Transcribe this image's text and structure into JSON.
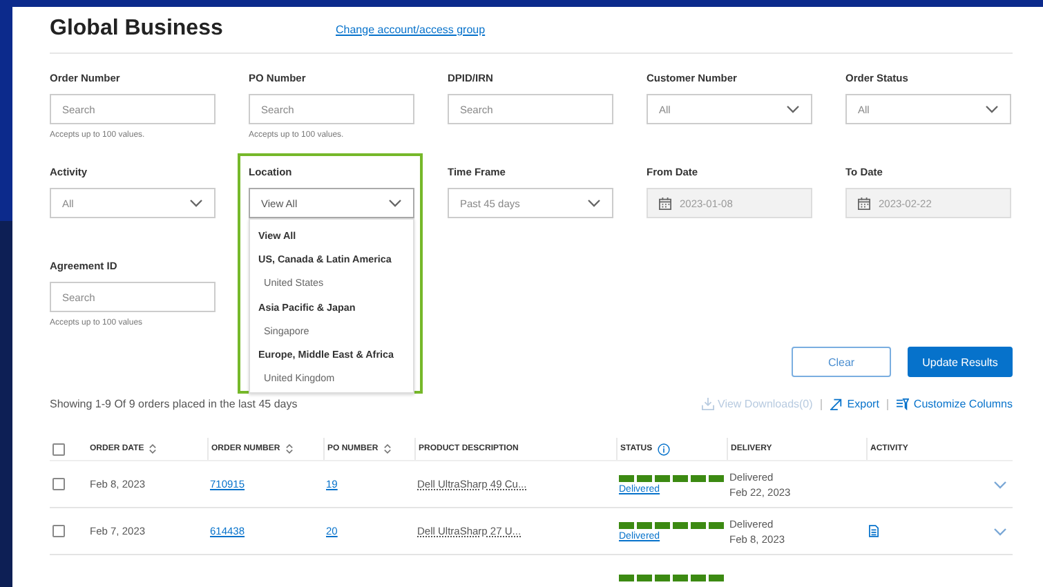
{
  "header": {
    "title": "Global Business",
    "link": "Change account/access group"
  },
  "filters": [
    {
      "kind": "text",
      "label": "Order Number",
      "placeholder": "Search",
      "help": "Accepts up to 100 values."
    },
    {
      "kind": "text",
      "label": "PO Number",
      "placeholder": "Search",
      "help": "Accepts up to 100 values."
    },
    {
      "kind": "text",
      "label": "DPID/IRN",
      "placeholder": "Search"
    },
    {
      "kind": "select",
      "label": "Customer Number",
      "value": "All"
    },
    {
      "kind": "select",
      "label": "Order Status",
      "value": "All"
    },
    {
      "kind": "select",
      "label": "Activity",
      "value": "All"
    },
    {
      "kind": "select",
      "label": "Location",
      "value": "View All",
      "focused": true,
      "open": true,
      "options": [
        {
          "kind": "group",
          "label": "View All"
        },
        {
          "kind": "group",
          "label": "US, Canada & Latin America"
        },
        {
          "kind": "item",
          "label": "United States"
        },
        {
          "kind": "group",
          "label": "Asia Pacific & Japan"
        },
        {
          "kind": "item",
          "label": "Singapore"
        },
        {
          "kind": "group",
          "label": "Europe, Middle East & Africa"
        },
        {
          "kind": "item",
          "label": "United Kingdom"
        }
      ]
    },
    {
      "kind": "select",
      "label": "Time Frame",
      "value": "Past 45 days"
    },
    {
      "kind": "date",
      "label": "From Date",
      "value": "2023-01-08",
      "disabled": true
    },
    {
      "kind": "date",
      "label": "To Date",
      "value": "2023-02-22",
      "disabled": true
    },
    {
      "kind": "text",
      "label": "Agreement ID",
      "placeholder": "Search",
      "help": "Accepts up to 100 values"
    }
  ],
  "buttons": {
    "clear": "Clear",
    "update": "Update Results"
  },
  "summary": "Showing 1-9 Of 9 orders placed in the last 45 days",
  "toolbar": [
    {
      "kind": "download",
      "label": "View Downloads(0)",
      "disabled": true
    },
    {
      "kind": "export",
      "label": "Export",
      "disabled": false
    },
    {
      "kind": "columns",
      "label": "Customize Columns",
      "disabled": false
    }
  ],
  "table": {
    "select_all_checked": false,
    "columns": [
      {
        "label": "ORDER DATE",
        "kind": "sortable"
      },
      {
        "label": "ORDER NUMBER",
        "kind": "sortable"
      },
      {
        "label": "PO NUMBER",
        "kind": "sortable"
      },
      {
        "label": "PRODUCT DESCRIPTION",
        "kind": "plain"
      },
      {
        "label": "STATUS",
        "kind": "info"
      },
      {
        "label": "DELIVERY",
        "kind": "plain"
      },
      {
        "label": "ACTIVITY",
        "kind": "plain"
      }
    ],
    "rows": [
      {
        "checked": false,
        "order_date": "Feb 8, 2023",
        "order_number": "710915",
        "po_number": "19",
        "product": "Dell UltraSharp 49 Cu...",
        "level": 1,
        "status": "Delivered",
        "delivery_status": "Delivered",
        "delivery_date": "Feb 22, 2023",
        "activity_icon": false
      },
      {
        "checked": false,
        "order_date": "Feb 7, 2023",
        "order_number": "614438",
        "po_number": "20",
        "product": "Dell UltraSharp 27 U...",
        "level": 1,
        "status": "Delivered",
        "delivery_status": "Delivered",
        "delivery_date": "Feb 8, 2023",
        "activity_icon": true
      },
      {
        "level": 1
      }
    ]
  }
}
